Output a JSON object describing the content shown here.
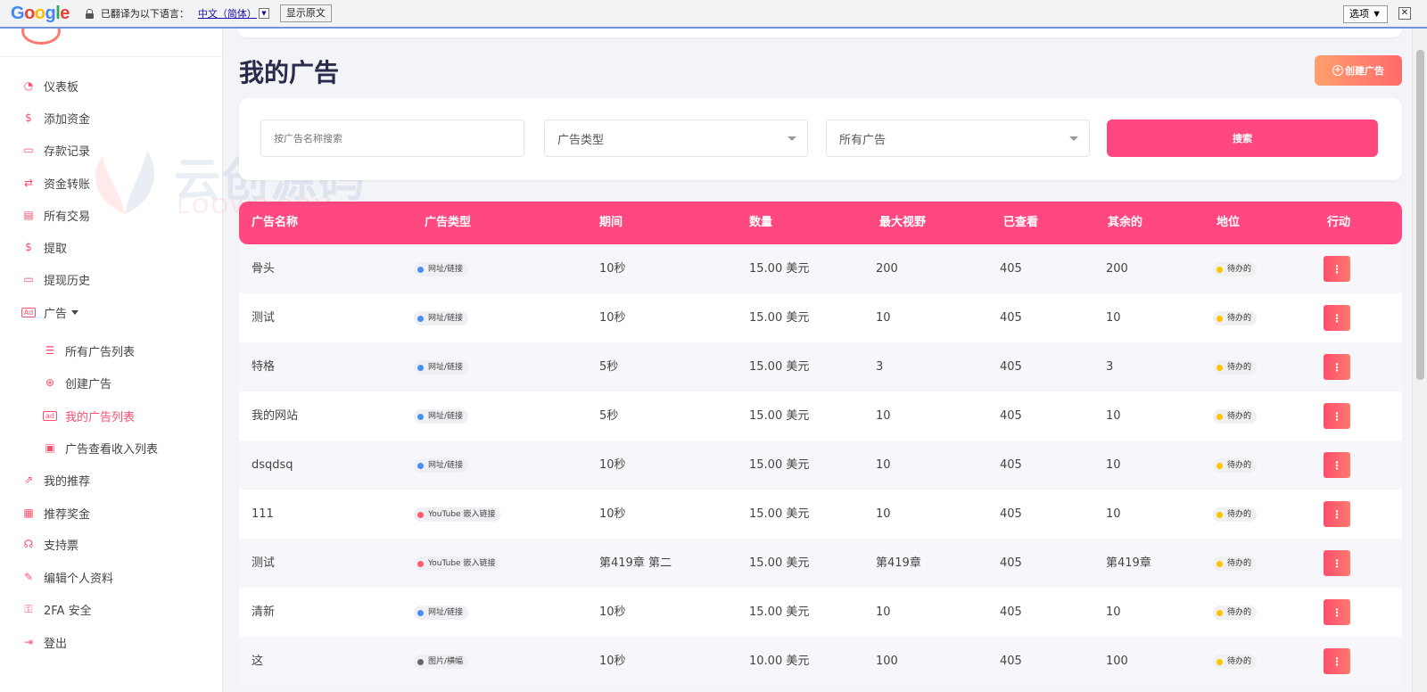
{
  "translate_bar": {
    "logo": "Google",
    "message": "已翻译为以下语言：",
    "language": "中文（简体）",
    "show_original": "显示原文",
    "options": "选项 ▼",
    "close": "✕"
  },
  "sidebar": {
    "items": [
      {
        "label": "仪表板",
        "icon": "dashboard-icon"
      },
      {
        "label": "添加资金",
        "icon": "money-bag-icon"
      },
      {
        "label": "存款记录",
        "icon": "deposit-card-icon"
      },
      {
        "label": "资金转账",
        "icon": "transfer-arrows-icon"
      },
      {
        "label": "所有交易",
        "icon": "transactions-icon"
      },
      {
        "label": "提取",
        "icon": "withdraw-icon"
      },
      {
        "label": "提现历史",
        "icon": "withdraw-history-icon"
      },
      {
        "label": "广告",
        "icon": "ad-icon"
      },
      {
        "label": "所有广告列表",
        "icon": "list-icon"
      },
      {
        "label": "创建广告",
        "icon": "plus-circle-icon"
      },
      {
        "label": "我的广告列表",
        "icon": "ad-badge-icon"
      },
      {
        "label": "广告查看收入列表",
        "icon": "cash-icon"
      },
      {
        "label": "我的推荐",
        "icon": "share-icon"
      },
      {
        "label": "推荐奖金",
        "icon": "bonus-icon"
      },
      {
        "label": "支持票",
        "icon": "support-icon"
      },
      {
        "label": "编辑个人资料",
        "icon": "user-edit-icon"
      },
      {
        "label": "2FA 安全",
        "icon": "user-lock-icon"
      },
      {
        "label": "登出",
        "icon": "logout-icon"
      }
    ]
  },
  "watermark": {
    "cn": "云创源码",
    "en": "LOOWP.COM"
  },
  "page": {
    "title": "我的广告",
    "create_button": "创建广告"
  },
  "filters": {
    "search_placeholder": "按广告名称搜索",
    "ad_type": "广告类型",
    "all_ads": "所有广告",
    "search_button": "搜索"
  },
  "table": {
    "headers": [
      "广告名称",
      "广告类型",
      "期间",
      "数量",
      "最大视野",
      "已查看",
      "其余的",
      "地位",
      "行动"
    ],
    "rows": [
      {
        "name": "骨头",
        "type": "网址/链接",
        "type_color": "#4a8ef0",
        "duration": "10秒",
        "amount": "15.00 美元",
        "max_views": "200",
        "viewed": "405",
        "remaining": "200",
        "status": "待办的"
      },
      {
        "name": "测试",
        "type": "网址/链接",
        "type_color": "#4a8ef0",
        "duration": "10秒",
        "amount": "15.00 美元",
        "max_views": "10",
        "viewed": "405",
        "remaining": "10",
        "status": "待办的"
      },
      {
        "name": "特格",
        "type": "网址/链接",
        "type_color": "#4a8ef0",
        "duration": "5秒",
        "amount": "15.00 美元",
        "max_views": "3",
        "viewed": "405",
        "remaining": "3",
        "status": "待办的"
      },
      {
        "name": "我的网站",
        "type": "网址/链接",
        "type_color": "#4a8ef0",
        "duration": "5秒",
        "amount": "15.00 美元",
        "max_views": "10",
        "viewed": "405",
        "remaining": "10",
        "status": "待办的"
      },
      {
        "name": "dsqdsq",
        "type": "网址/链接",
        "type_color": "#4a8ef0",
        "duration": "10秒",
        "amount": "15.00 美元",
        "max_views": "10",
        "viewed": "405",
        "remaining": "10",
        "status": "待办的"
      },
      {
        "name": "111",
        "type": "YouTube 嵌入链接",
        "type_color": "#ff5a6e",
        "duration": "10秒",
        "amount": "15.00 美元",
        "max_views": "10",
        "viewed": "405",
        "remaining": "10",
        "status": "待办的"
      },
      {
        "name": "测试",
        "type": "YouTube 嵌入链接",
        "type_color": "#ff5a6e",
        "duration": "第419章 第二",
        "amount": "15.00 美元",
        "max_views": "第419章",
        "viewed": "405",
        "remaining": "第419章",
        "status": "待办的"
      },
      {
        "name": "清新",
        "type": "网址/链接",
        "type_color": "#4a8ef0",
        "duration": "10秒",
        "amount": "15.00 美元",
        "max_views": "10",
        "viewed": "405",
        "remaining": "10",
        "status": "待办的"
      },
      {
        "name": "这",
        "type": "图片/横幅",
        "type_color": "#666666",
        "duration": "10秒",
        "amount": "10.00 美元",
        "max_views": "100",
        "viewed": "405",
        "remaining": "100",
        "status": "待办的"
      }
    ],
    "action_glyph": "⋮"
  },
  "colors": {
    "accent": "#ff4880",
    "title": "#2a2a4a",
    "pending": "#ffc400"
  }
}
